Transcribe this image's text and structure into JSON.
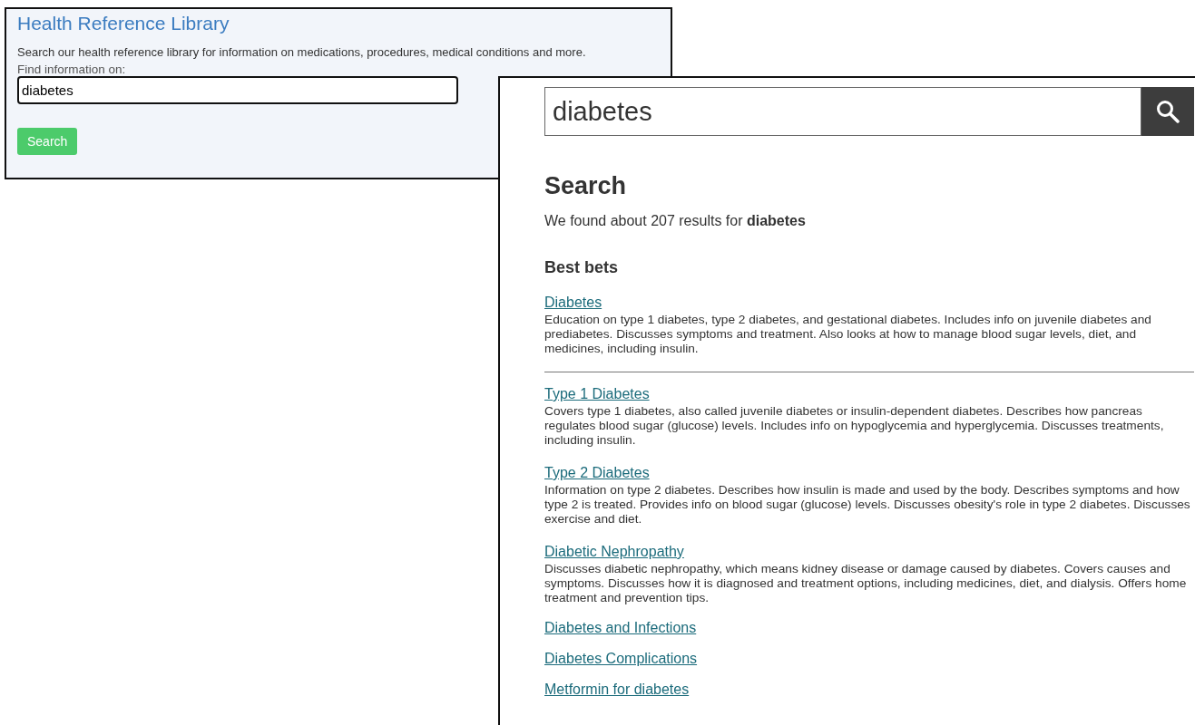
{
  "library_panel": {
    "title": "Health Reference Library",
    "description": "Search our health reference library for information on medications, procedures, medical conditions and more.",
    "field_label": "Find information on:",
    "search_field": {
      "value": "diabetes"
    },
    "search_button": "Search"
  },
  "results_panel": {
    "search_field": {
      "value": "diabetes"
    },
    "heading": "Search",
    "summary": "We found about 207 results for **diabetes**",
    "best_bets_heading": "Best bets",
    "results": [
      {
        "title": "Diabetes",
        "description": "Education on type 1 diabetes, type 2 diabetes, and gestational diabetes. Includes info on juvenile diabetes and prediabetes. Discusses symptoms and treatment. Also looks at how to manage blood sugar levels, diet, and medicines, including insulin.",
        "divider_after": true
      },
      {
        "title": "Type 1 Diabetes",
        "description": "Covers type 1 diabetes, also called juvenile diabetes or insulin-dependent diabetes. Describes how pancreas regulates blood sugar (glucose) levels. Includes info on hypoglycemia and hyperglycemia. Discusses treatments, including insulin.",
        "divider_after": false
      },
      {
        "title": "Type 2 Diabetes",
        "description": "Information on type 2 diabetes. Describes how insulin is made and used by the body. Describes symptoms and how type 2 is treated. Provides info on blood sugar (glucose) levels. Discusses obesity's role in type 2 diabetes. Discusses exercise and diet.",
        "divider_after": false
      },
      {
        "title": "Diabetic Nephropathy",
        "description": "Discusses diabetic nephropathy, which means kidney disease or damage caused by diabetes. Covers causes and symptoms. Discusses how it is diagnosed and treatment options, including medicines, diet, and dialysis. Offers home treatment and prevention tips.",
        "divider_after": false
      },
      {
        "title": "Diabetes and Infections",
        "divider_after": false
      },
      {
        "title": "Diabetes Complications",
        "divider_after": false
      },
      {
        "title": "Metformin for diabetes",
        "divider_after": false
      }
    ]
  }
}
